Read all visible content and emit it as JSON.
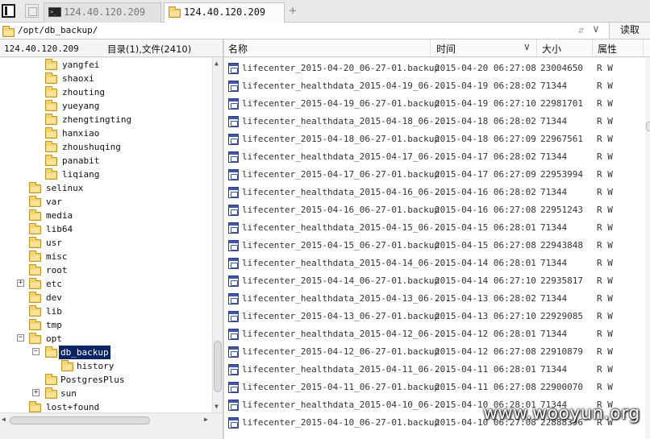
{
  "tabs": [
    {
      "label": "124.40.120.209",
      "icon": "terminal-icon"
    },
    {
      "label": "124.40.120.209",
      "icon": "folder-icon"
    }
  ],
  "new_tab_symbol": "+",
  "path": {
    "value": "/opt/db_backup/",
    "history_arrows": "⇵",
    "dropdown": "∨",
    "read_button": "读取"
  },
  "left_panel": {
    "host": "124.40.120.209",
    "count": "目录(1),文件(2410)"
  },
  "tree": [
    {
      "label": "yangfei"
    },
    {
      "label": "shaoxi"
    },
    {
      "label": "zhouting"
    },
    {
      "label": "yueyang"
    },
    {
      "label": "zhengtingting"
    },
    {
      "label": "hanxiao"
    },
    {
      "label": "zhoushuqing"
    },
    {
      "label": "panabit"
    },
    {
      "label": "liqiang"
    },
    {
      "label": "selinux"
    },
    {
      "label": "var"
    },
    {
      "label": "media"
    },
    {
      "label": "lib64"
    },
    {
      "label": "usr"
    },
    {
      "label": "misc"
    },
    {
      "label": "root"
    },
    {
      "label": "etc",
      "expander": "+"
    },
    {
      "label": "dev"
    },
    {
      "label": "lib"
    },
    {
      "label": "tmp"
    },
    {
      "label": "opt",
      "expander": "−"
    },
    {
      "label": "db_backup",
      "expander": "−",
      "selected": true
    },
    {
      "label": "history"
    },
    {
      "label": "PostgresPlus"
    },
    {
      "label": "sun",
      "expander": "+"
    },
    {
      "label": "lost+found"
    }
  ],
  "columns": {
    "name": "名称",
    "time": "时间",
    "size": "大小",
    "attr": "属性"
  },
  "files": [
    {
      "name": "lifecenter_2015-04-20_06-27-01.backup",
      "time": "2015-04-20 06:27:08",
      "size": "23004650",
      "attr": "R W"
    },
    {
      "name": "lifecenter_healthdata_2015-04-19_06-...",
      "time": "2015-04-19 06:28:02",
      "size": "71344",
      "attr": "R W"
    },
    {
      "name": "lifecenter_2015-04-19_06-27-01.backup",
      "time": "2015-04-19 06:27:10",
      "size": "22981701",
      "attr": "R W"
    },
    {
      "name": "lifecenter_healthdata_2015-04-18_06-...",
      "time": "2015-04-18 06:28:02",
      "size": "71344",
      "attr": "R W"
    },
    {
      "name": "lifecenter_2015-04-18_06-27-01.backup",
      "time": "2015-04-18 06:27:09",
      "size": "22967561",
      "attr": "R W"
    },
    {
      "name": "lifecenter_healthdata_2015-04-17_06-...",
      "time": "2015-04-17 06:28:02",
      "size": "71344",
      "attr": "R W"
    },
    {
      "name": "lifecenter_2015-04-17_06-27-01.backup",
      "time": "2015-04-17 06:27:09",
      "size": "22953994",
      "attr": "R W"
    },
    {
      "name": "lifecenter_healthdata_2015-04-16_06-...",
      "time": "2015-04-16 06:28:02",
      "size": "71344",
      "attr": "R W"
    },
    {
      "name": "lifecenter_2015-04-16_06-27-01.backup",
      "time": "2015-04-16 06:27:08",
      "size": "22951243",
      "attr": "R W"
    },
    {
      "name": "lifecenter_healthdata_2015-04-15_06-...",
      "time": "2015-04-15 06:28:01",
      "size": "71344",
      "attr": "R W"
    },
    {
      "name": "lifecenter_2015-04-15_06-27-01.backup",
      "time": "2015-04-15 06:27:08",
      "size": "22943848",
      "attr": "R W"
    },
    {
      "name": "lifecenter_healthdata_2015-04-14_06-...",
      "time": "2015-04-14 06:28:01",
      "size": "71344",
      "attr": "R W"
    },
    {
      "name": "lifecenter_2015-04-14_06-27-01.backup",
      "time": "2015-04-14 06:27:10",
      "size": "22935817",
      "attr": "R W"
    },
    {
      "name": "lifecenter_healthdata_2015-04-13_06-...",
      "time": "2015-04-13 06:28:02",
      "size": "71344",
      "attr": "R W"
    },
    {
      "name": "lifecenter_2015-04-13_06-27-01.backup",
      "time": "2015-04-13 06:27:10",
      "size": "22929085",
      "attr": "R W"
    },
    {
      "name": "lifecenter_healthdata_2015-04-12_06-...",
      "time": "2015-04-12 06:28:01",
      "size": "71344",
      "attr": "R W"
    },
    {
      "name": "lifecenter_2015-04-12_06-27-01.backup",
      "time": "2015-04-12 06:27:08",
      "size": "22910879",
      "attr": "R W"
    },
    {
      "name": "lifecenter_healthdata_2015-04-11_06-...",
      "time": "2015-04-11 06:28:01",
      "size": "71344",
      "attr": "R W"
    },
    {
      "name": "lifecenter_2015-04-11_06-27-01.backup",
      "time": "2015-04-11 06:27:08",
      "size": "22900070",
      "attr": "R W"
    },
    {
      "name": "lifecenter_healthdata_2015-04-10_06-...",
      "time": "2015-04-10 06:28:01",
      "size": "71344",
      "attr": "R W"
    },
    {
      "name": "lifecenter_2015-04-10_06-27-01.backup",
      "time": "2015-04-10 06:27:08",
      "size": "22888396",
      "attr": "R W"
    }
  ],
  "watermark": "www.wooyun.org"
}
